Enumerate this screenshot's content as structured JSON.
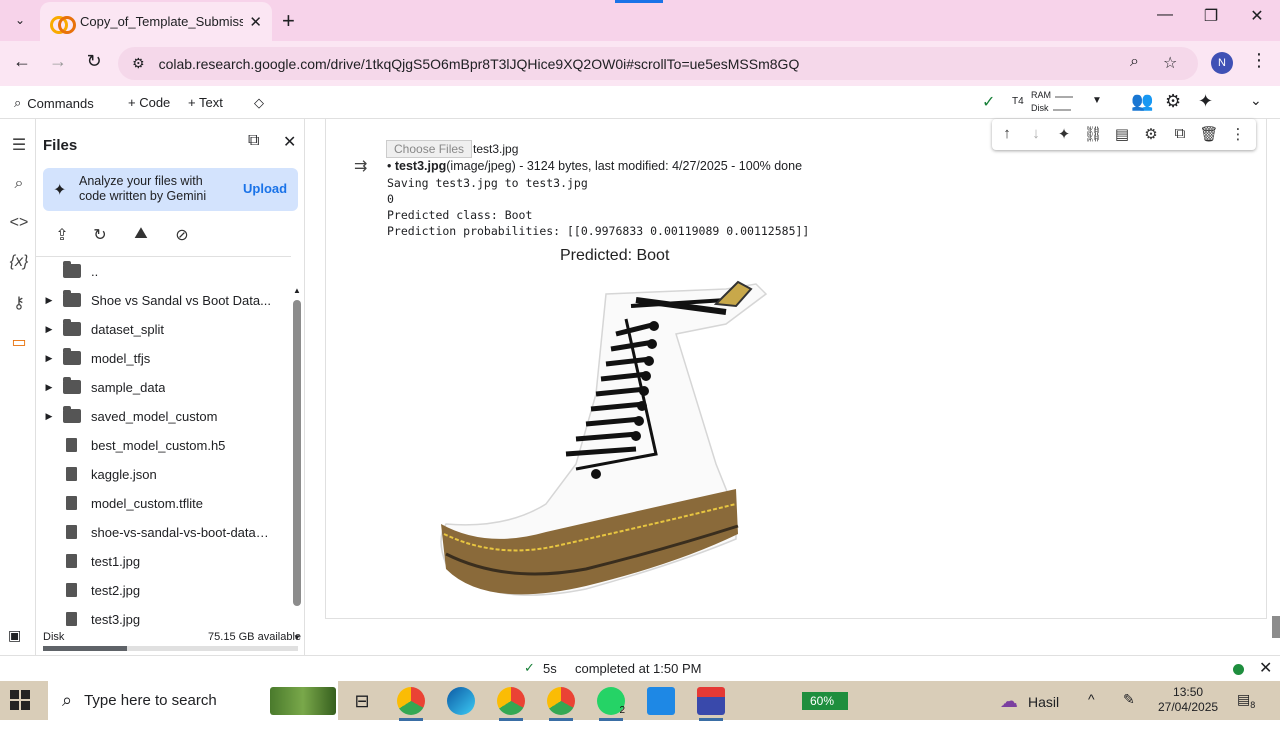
{
  "browser": {
    "tab_title": "Copy_of_Template_Submission",
    "url": "colab.research.google.com/drive/1tkqQjgS5O6mBpr8T3lJQHice9XQ2OW0i#scrollTo=ue5esMSSm8GQ",
    "profile_initial": "N"
  },
  "colab_toolbar": {
    "commands": "Commands",
    "code": "+ Code",
    "text": "+ Text",
    "runtime": "T4",
    "ram": "RAM",
    "disk": "Disk"
  },
  "files_panel": {
    "title": "Files",
    "gemini_text": "Analyze your files with code written by Gemini",
    "upload": "Upload",
    "items": [
      {
        "name": "..",
        "type": "parent"
      },
      {
        "name": "Shoe vs Sandal vs Boot Data...",
        "type": "folder"
      },
      {
        "name": "dataset_split",
        "type": "folder"
      },
      {
        "name": "model_tfjs",
        "type": "folder"
      },
      {
        "name": "sample_data",
        "type": "folder"
      },
      {
        "name": "saved_model_custom",
        "type": "folder"
      },
      {
        "name": "best_model_custom.h5",
        "type": "file"
      },
      {
        "name": "kaggle.json",
        "type": "file"
      },
      {
        "name": "model_custom.tflite",
        "type": "file"
      },
      {
        "name": "shoe-vs-sandal-vs-boot-datas...",
        "type": "file"
      },
      {
        "name": "test1.jpg",
        "type": "file"
      },
      {
        "name": "test2.jpg",
        "type": "file"
      },
      {
        "name": "test3.jpg",
        "type": "file"
      }
    ],
    "disk_label": "Disk",
    "disk_available": "75.15 GB available",
    "disk_used_fraction": 0.33
  },
  "cell_output": {
    "choose_files": "Choose Files",
    "chosen_file": "test3.jpg",
    "upload_file_bold": "test3.jpg",
    "upload_file_rest": "(image/jpeg) - 3124 bytes, last modified: 4/27/2025 - 100% done",
    "lines": [
      "Saving test3.jpg to test3.jpg",
      "0",
      "Predicted class: Boot",
      "Prediction probabilities: [[0.9976833  0.00119089 0.00112585]]"
    ],
    "plot_title": "Predicted: Boot"
  },
  "statusbar": {
    "duration": "5s",
    "completed": "completed at 1:50 PM"
  },
  "taskbar": {
    "search_placeholder": "Type here to search",
    "battery": "60%",
    "weather": "Hasil",
    "whatsapp_badge": "2",
    "time": "13:50",
    "date": "27/04/2025",
    "notif_badge": "8"
  }
}
